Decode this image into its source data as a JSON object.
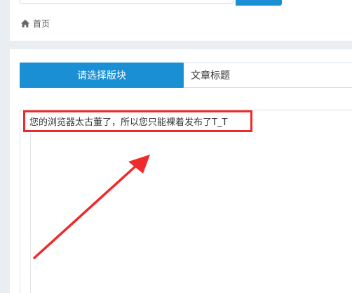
{
  "breadcrumb": {
    "home_label": "首页"
  },
  "editor": {
    "select_block_label": "请选择版块",
    "title_value": "文章标题",
    "message": "您的浏览器太古董了，所以您只能裸着发布了T_T"
  },
  "colors": {
    "accent": "#1a8fd4",
    "highlight": "#f02a2a",
    "background": "#e9eef3"
  },
  "icons": {
    "home": "home-icon",
    "annotation": "arrow-icon"
  }
}
